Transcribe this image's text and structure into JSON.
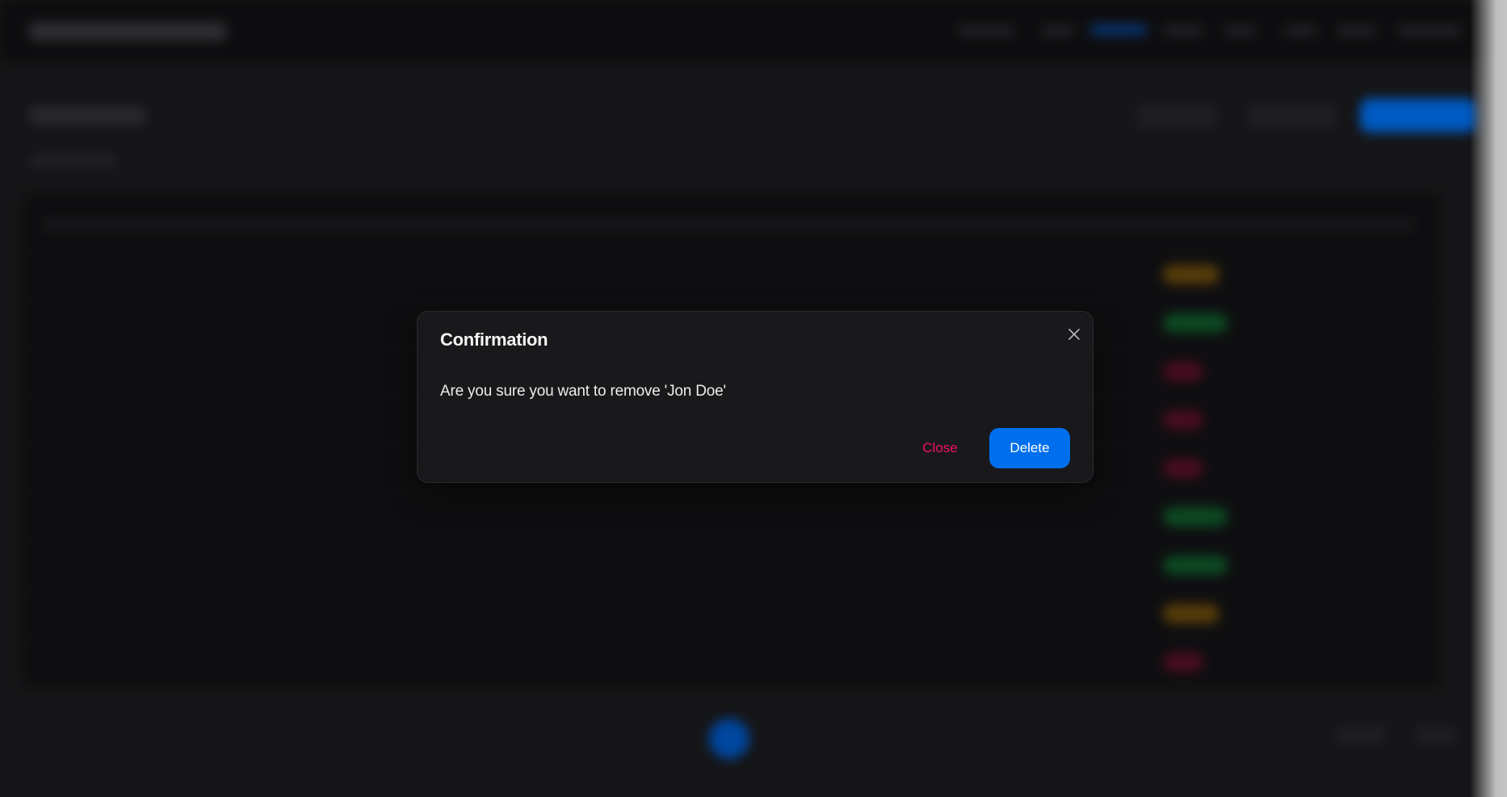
{
  "dialog": {
    "title": "Confirmation",
    "message": "Are you sure you want to remove 'Jon Doe'",
    "close_label": "Close",
    "delete_label": "Delete",
    "close_icon": "close-icon"
  },
  "colors": {
    "primary": "#006fee",
    "danger": "#f31260",
    "success": "#17c964",
    "warning": "#f5a524",
    "surface": "#19191b"
  }
}
